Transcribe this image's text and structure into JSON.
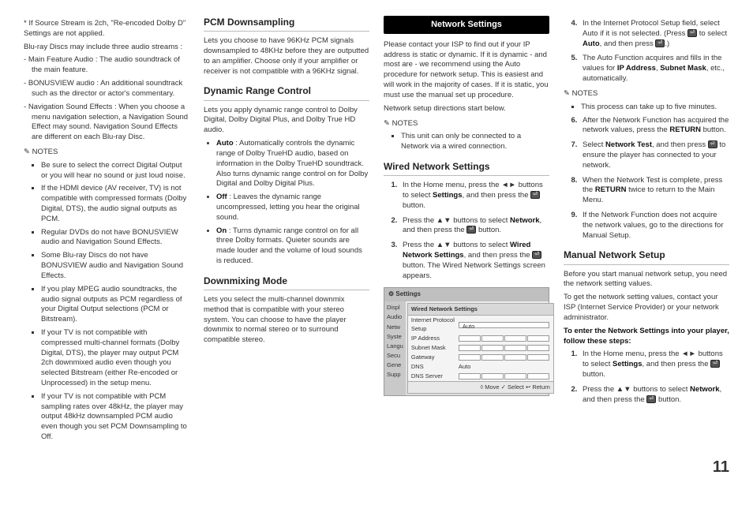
{
  "col1": {
    "intro_star": "If Source Stream is 2ch, \"Re-encoded Dolby D\" Settings are not applied.",
    "intro_line": "Blu-ray Discs may include three audio streams :",
    "streams": [
      "Main Feature Audio : The audio soundtrack of the main feature.",
      "BONUSVIEW audio : An additional soundtrack such as the director or actor's commentary.",
      "Navigation Sound Effects : When you choose a menu navigation selection, a Navigation Sound Effect may sound. Navigation Sound Effects are different on each Blu-ray Disc."
    ],
    "notes_label": "NOTES",
    "notes": [
      "Be sure to select the correct Digital Output or you will hear no sound or just loud noise.",
      "If the HDMI device (AV receiver, TV) is not compatible with compressed formats (Dolby Digital, DTS), the audio signal outputs as PCM.",
      "Regular DVDs do not have BONUSVIEW audio and Navigation Sound Effects.",
      "Some Blu-ray Discs do not have BONUSVIEW audio and Navigation Sound Effects.",
      "If you play MPEG audio soundtracks, the audio signal outputs as PCM regardless of your Digital Output selections (PCM or Bitstream).",
      "If your TV is not compatible with compressed multi-channel formats (Dolby Digital, DTS), the player may output PCM 2ch downmixed audio even though you selected Bitstream (either Re-encoded or Unprocessed) in the setup menu.",
      "If your TV is not compatible with PCM sampling rates over 48kHz, the player may output 48kHz downsampled PCM audio even though you set PCM Downsampling to Off."
    ]
  },
  "col2": {
    "pcm_title": "PCM Downsampling",
    "pcm_body": "Lets you choose to have 96KHz PCM signals downsampled to 48KHz before they are outputted to an amplifier. Choose only if your amplifier or receiver is not compatible with a 96KHz signal.",
    "drc_title": "Dynamic Range Control",
    "drc_body": "Lets you apply dynamic range control to Dolby Digital, Dolby Digital Plus, and Dolby True HD audio.",
    "drc_auto_b": "Auto",
    "drc_auto": " : Automatically controls the dynamic range of Dolby TrueHD audio, based on information in the Dolby TrueHD soundtrack.",
    "drc_auto2": "Also turns dynamic range control on for Dolby Digital and Dolby Digital Plus.",
    "drc_off_b": "Off",
    "drc_off": " : Leaves the dynamic range uncompressed, letting you hear the original sound.",
    "drc_on_b": "On",
    "drc_on": " : Turns dynamic range control on for all three Dolby formats. Quieter sounds are made louder and the volume of loud sounds is reduced.",
    "down_title": "Downmixing Mode",
    "down_body": "Lets you select the multi-channel downmix method that is compatible with your stereo system. You can choose to have the player downmix to normal stereo or to surround compatible stereo."
  },
  "col3": {
    "net_title": "Network Settings",
    "net_body1": "Please contact your ISP to find out if your IP address is static or dynamic. If it is dynamic - and most are - we recommend using the Auto procedure for network setup. This is easiest and will work in the majority of cases. If it is static, you must use the manual set up procedure.",
    "net_body2": "Network setup directions start below.",
    "notes_label": "NOTES",
    "note1": "This unit can only be connected to a Network via a wired connection.",
    "wired_title": "Wired Network Settings",
    "step1a": "In the Home menu, press the ◄► buttons to select ",
    "step1b": "Settings",
    "step1c": ", and then press the ",
    "step1d": " button.",
    "step2a": "Press the ▲▼ buttons to select ",
    "step2b": "Network",
    "step2c": ", and then press the ",
    "step2d": " button.",
    "step3a": "Press the ▲▼ buttons to select ",
    "step3b": "Wired Network Settings",
    "step3c": ", and then press the ",
    "step3d": " button. The Wired Network Settings screen appears.",
    "dlg_head": "⚙ Settings",
    "dlg_side": [
      "Displ",
      "Audio",
      "Netw",
      "Syste",
      "Langu",
      "Secu",
      "Gene",
      "Supp"
    ],
    "dlg_title2": "Wired Network Settings",
    "dlg_rows": {
      "r1": "Internet Protocol Setup",
      "r1v": "Auto",
      "r2": "IP Address",
      "r3": "Subnet Mask",
      "r4": "Gateway",
      "r5": "DNS",
      "r5v": "Auto",
      "r6": "DNS Server"
    },
    "dlg_foot": "◊ Move   ✓ Select   ↩ Return"
  },
  "col4": {
    "step4a": "In the Internet Protocol Setup field, select Auto if it is not selected. (Press ",
    "step4b": " to select ",
    "step4c": "Auto",
    "step4d": ", and then press ",
    "step4e": ".)",
    "step5a": "The Auto Function acquires and fills in the values for ",
    "step5b": "IP Address",
    "step5c": ", ",
    "step5d": "Subnet Mask",
    "step5e": ", etc., automatically.",
    "notes_label": "NOTES",
    "note1": "This process can take up to five minutes.",
    "step6a": "After the Network Function has acquired the network values, press the ",
    "step6b": "RETURN",
    "step6c": " button.",
    "step7a": "Select ",
    "step7b": "Network Test",
    "step7c": ", and then press ",
    "step7d": " to ensure the player has connected to your network.",
    "step8a": "When the Network Test is complete, press the ",
    "step8b": "RETURN",
    "step8c": " twice to return to the Main Menu.",
    "step9": "If the Network Function does not acquire the network values, go to the directions for Manual Setup.",
    "manual_title": "Manual Network Setup",
    "manual_p1": "Before you start manual network setup, you need the network setting values.",
    "manual_p2": "To get the network setting values, contact your ISP (Internet Service Provider) or your network administrator.",
    "manual_bold": "To enter the Network Settings into your player, follow these steps:",
    "ms1a": "In the Home menu, press the ◄► buttons to select ",
    "ms1b": "Settings",
    "ms1c": ", and then press the ",
    "ms1d": " button.",
    "ms2a": "Press the ▲▼ buttons to select ",
    "ms2b": "Network",
    "ms2c": ", and then press the ",
    "ms2d": " button."
  },
  "page_number": "11"
}
